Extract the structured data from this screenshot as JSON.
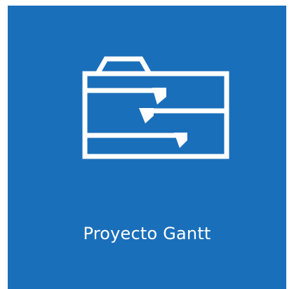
{
  "tile": {
    "label": "Proyecto Gantt",
    "icon": "gantt-folder-icon",
    "background_color": "#1a6fba",
    "foreground_color": "#ffffff"
  }
}
